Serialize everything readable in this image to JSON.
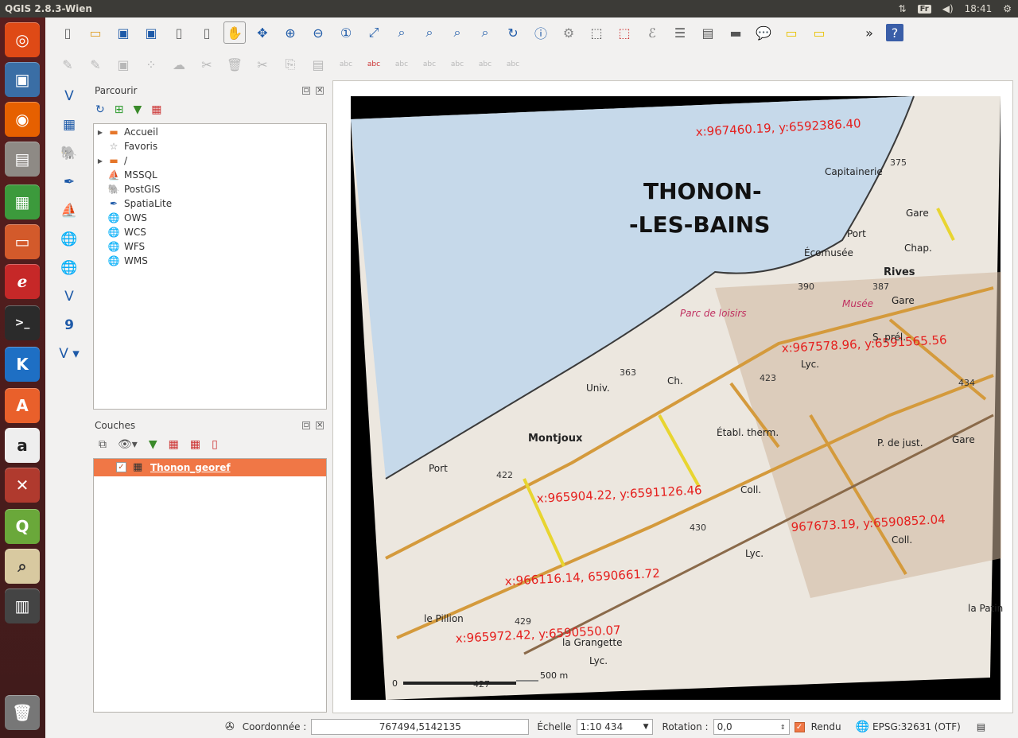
{
  "window": {
    "title": "QGIS 2.8.3-Wien"
  },
  "top_bar": {
    "keyboard": "Fr",
    "time": "18:41"
  },
  "launcher": {
    "items": [
      "ubuntu-logo-icon",
      "image-viewer-icon",
      "firefox-icon",
      "files-icon",
      "spreadsheet-icon",
      "presentation-icon",
      "document-viewer-icon",
      "terminal-icon",
      "k-icon",
      "software-center-icon",
      "amazon-icon",
      "settings-icon",
      "qgis-icon",
      "map-app-icon",
      "save-icon",
      "trash-icon"
    ]
  },
  "browser": {
    "title": "Parcourir",
    "items": [
      {
        "label": "Accueil",
        "expandable": true,
        "icon": "folder-icon"
      },
      {
        "label": "Favoris",
        "expandable": false,
        "icon": "star-icon"
      },
      {
        "label": "/",
        "expandable": true,
        "icon": "folder-icon"
      },
      {
        "label": "MSSQL",
        "expandable": false,
        "icon": "mssql-icon"
      },
      {
        "label": "PostGIS",
        "expandable": false,
        "icon": "postgis-icon"
      },
      {
        "label": "SpatiaLite",
        "expandable": false,
        "icon": "spatialite-icon"
      },
      {
        "label": "OWS",
        "expandable": false,
        "icon": "globe-icon"
      },
      {
        "label": "WCS",
        "expandable": false,
        "icon": "globe-icon"
      },
      {
        "label": "WFS",
        "expandable": false,
        "icon": "globe-icon"
      },
      {
        "label": "WMS",
        "expandable": false,
        "icon": "globe-icon"
      }
    ]
  },
  "layers": {
    "title": "Couches",
    "items": [
      {
        "name": "Thonon_georef",
        "checked": true
      }
    ]
  },
  "map": {
    "title_line1": "THONON-",
    "title_line2": "-LES-BAINS",
    "labels": [
      "Capitainerie",
      "Gare",
      "Chap.",
      "Port",
      "Écomusée",
      "Rives",
      "Musée",
      "Gare",
      "S. prél.",
      "Parc de loisirs",
      "Univ.",
      "Ch.",
      "Lyc.",
      "Montjoux",
      "Port",
      "Établ. therm.",
      "P. de just.",
      "Gare",
      "Coll.",
      "Lyc.",
      "Coll.",
      "le Pillion",
      "la Grangette",
      "Lyc.",
      "la Patin"
    ],
    "elevations": [
      "375",
      "390",
      "387",
      "363",
      "423",
      "434",
      "422",
      "430",
      "429",
      "427"
    ],
    "coordinates": [
      "x:967460.19, y:6592386.40",
      "x:967578.96, y:6591565.56",
      "x:965904.22, y:6591126.46",
      "967673.19, y:6590852.04",
      "x:966116.14, 6590661.72",
      "x:965972.42, y:6590550.07"
    ],
    "scale_bar": {
      "start": "0",
      "end": "500 m"
    }
  },
  "statusbar": {
    "coord_label": "Coordonnée :",
    "coord_value": "767494,5142135",
    "scale_label": "Échelle",
    "scale_value": "1:10 434",
    "rotation_label": "Rotation :",
    "rotation_value": "0,0",
    "render_label": "Rendu",
    "render_checked": true,
    "crs": "EPSG:32631 (OTF)"
  },
  "colors": {
    "accent": "#f07746",
    "water": "#c4d8ea",
    "land": "#ebe6de",
    "road": "#d6a14a",
    "coord_text": "#e5201e"
  }
}
